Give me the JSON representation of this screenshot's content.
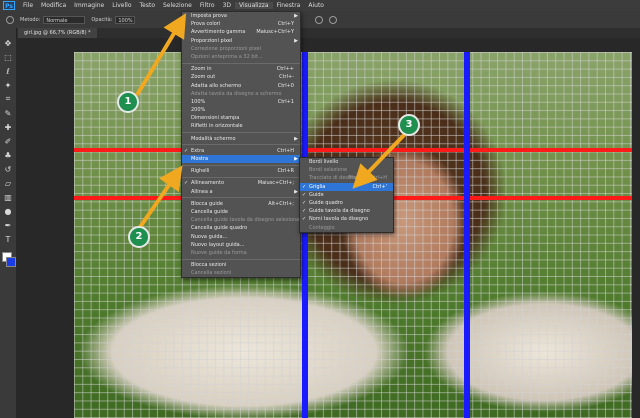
{
  "menubar": {
    "logo": "Ps",
    "items": [
      "File",
      "Modifica",
      "Immagine",
      "Livello",
      "Testo",
      "Selezione",
      "Filtro",
      "3D",
      "Visualizza",
      "Finestra",
      "Aiuto"
    ],
    "active": "Visualizza"
  },
  "options": {
    "method_label": "Metodo:",
    "method_value": "Normale",
    "opacity_label": "Opacità:",
    "opacity_value": "100%"
  },
  "document": {
    "tab": "girl.jpg @ 66,7% (RGB/8) *"
  },
  "view_menu": [
    {
      "label": "Imposta prova",
      "submenu": true
    },
    {
      "label": "Prova colori",
      "shortcut": "Ctrl+Y"
    },
    {
      "label": "Avvertimento gamma",
      "shortcut": "Maiusc+Ctrl+Y"
    },
    {
      "label": "Proporzioni pixel",
      "submenu": true
    },
    {
      "label": "Correzione proporzioni pixel",
      "dim": true
    },
    {
      "label": "Opzioni anteprima a 32 bit...",
      "dim": true
    },
    {
      "sep": true
    },
    {
      "label": "Zoom in",
      "shortcut": "Ctrl++"
    },
    {
      "label": "Zoom out",
      "shortcut": "Ctrl+-"
    },
    {
      "label": "Adatta allo schermo",
      "shortcut": "Ctrl+0"
    },
    {
      "label": "Adatta tavola da disegno a schermo",
      "dim": true
    },
    {
      "label": "100%",
      "shortcut": "Ctrl+1"
    },
    {
      "label": "200%"
    },
    {
      "label": "Dimensioni stampa"
    },
    {
      "label": "Rifletti in orizzontale"
    },
    {
      "sep": true
    },
    {
      "label": "Modalità schermo",
      "submenu": true
    },
    {
      "sep": true
    },
    {
      "label": "Extra",
      "shortcut": "Ctrl+H",
      "check": true
    },
    {
      "label": "Mostra",
      "submenu": true,
      "highlight": true
    },
    {
      "sep": true
    },
    {
      "label": "Righelli",
      "shortcut": "Ctrl+R"
    },
    {
      "sep": true
    },
    {
      "label": "Allineamento",
      "shortcut": "Maiusc+Ctrl+;",
      "check": true
    },
    {
      "label": "Allinea a",
      "submenu": true
    },
    {
      "sep": true
    },
    {
      "label": "Blocca guide",
      "shortcut": "Alt+Ctrl+;"
    },
    {
      "label": "Cancella guide"
    },
    {
      "label": "Cancella guide tavola da disegno selezionate",
      "dim": true
    },
    {
      "label": "Cancella guide quadro"
    },
    {
      "label": "Nuova guida..."
    },
    {
      "label": "Nuovo layout guida..."
    },
    {
      "label": "Nuove guide da forma",
      "dim": true
    },
    {
      "sep": true
    },
    {
      "label": "Blocca sezioni"
    },
    {
      "label": "Cancella sezioni",
      "dim": true
    }
  ],
  "show_submenu": [
    {
      "label": "Bordi livello"
    },
    {
      "label": "Bordi selezione",
      "dim": true
    },
    {
      "label": "Tracciato di destinazione",
      "shortcut": "Maiusc+Ctrl+H",
      "dim": true
    },
    {
      "label": "Griglia",
      "shortcut": "Ctrl+'",
      "highlight": true,
      "check": true
    },
    {
      "label": "Guide",
      "check": true
    },
    {
      "label": "Guide quadro",
      "check": true
    },
    {
      "label": "Guide tavola da disegno",
      "check": true
    },
    {
      "label": "Nomi tavola da disegno",
      "check": true
    },
    {
      "label": "Conteggio",
      "dim": true
    }
  ],
  "badges": [
    "1",
    "2",
    "3"
  ],
  "colors": {
    "accent": "#2e75d6",
    "badge": "#1f8f4f",
    "arrow": "#f0a820",
    "guide_h": "#ff1a1a",
    "guide_v": "#1a1aff"
  }
}
